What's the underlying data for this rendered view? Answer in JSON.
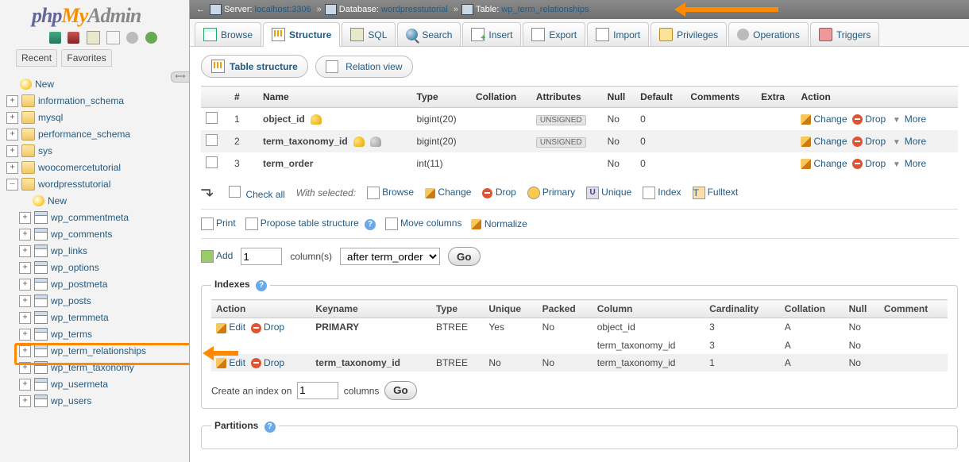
{
  "logo": {
    "p": "php",
    "m": "My",
    "a": "Admin"
  },
  "nav": {
    "recent": "Recent",
    "favorites": "Favorites"
  },
  "tree": {
    "new": "New",
    "dbs": [
      "information_schema",
      "mysql",
      "performance_schema",
      "sys",
      "woocomercetutorial"
    ],
    "open_db": "wordpresstutorial",
    "tables": [
      "wp_commentmeta",
      "wp_comments",
      "wp_links",
      "wp_options",
      "wp_postmeta",
      "wp_posts",
      "wp_termmeta",
      "wp_terms",
      "wp_term_relationships",
      "wp_term_taxonomy",
      "wp_usermeta",
      "wp_users"
    ]
  },
  "bc": {
    "server_lbl": "Server:",
    "server": "localhost:3306",
    "db_lbl": "Database:",
    "db": "wordpresstutorial",
    "tbl_lbl": "Table:",
    "tbl": "wp_term_relationships"
  },
  "tabs": {
    "browse": "Browse",
    "structure": "Structure",
    "sql": "SQL",
    "search": "Search",
    "insert": "Insert",
    "export": "Export",
    "import": "Import",
    "privileges": "Privileges",
    "operations": "Operations",
    "triggers": "Triggers"
  },
  "subtabs": {
    "ts": "Table structure",
    "rv": "Relation view"
  },
  "cols": {
    "headers": {
      "num": "#",
      "name": "Name",
      "type": "Type",
      "collation": "Collation",
      "attributes": "Attributes",
      "null": "Null",
      "default": "Default",
      "comments": "Comments",
      "extra": "Extra",
      "action": "Action"
    },
    "rows": [
      {
        "n": "1",
        "name": "object_id",
        "type": "bigint(20)",
        "attr": "UNSIGNED",
        "null": "No",
        "def": "0",
        "pk": true
      },
      {
        "n": "2",
        "name": "term_taxonomy_id",
        "type": "bigint(20)",
        "attr": "UNSIGNED",
        "null": "No",
        "def": "0",
        "pk": true,
        "idx": true
      },
      {
        "n": "3",
        "name": "term_order",
        "type": "int(11)",
        "attr": "",
        "null": "No",
        "def": "0"
      }
    ],
    "change": "Change",
    "drop": "Drop",
    "more": "More"
  },
  "wsel": {
    "checkall": "Check all",
    "label": "With selected:",
    "browse": "Browse",
    "change": "Change",
    "drop": "Drop",
    "primary": "Primary",
    "unique": "Unique",
    "index": "Index",
    "fulltext": "Fulltext"
  },
  "tools": {
    "print": "Print",
    "propose": "Propose table structure",
    "move": "Move columns",
    "norm": "Normalize"
  },
  "addrow": {
    "add": "Add",
    "count": "1",
    "col": "column(s)",
    "after_options": [
      "after term_order"
    ],
    "after": "after term_order",
    "go": "Go"
  },
  "indexes": {
    "legend": "Indexes",
    "headers": {
      "action": "Action",
      "key": "Keyname",
      "type": "Type",
      "unique": "Unique",
      "packed": "Packed",
      "column": "Column",
      "card": "Cardinality",
      "coll": "Collation",
      "null": "Null",
      "comment": "Comment"
    },
    "rows": [
      {
        "edit": "Edit",
        "drop": "Drop",
        "key": "PRIMARY",
        "type": "BTREE",
        "uni": "Yes",
        "packed": "No",
        "col": "object_id",
        "card": "3",
        "coll": "A",
        "null": "No"
      },
      {
        "cont": true,
        "col": "term_taxonomy_id",
        "card": "3",
        "coll": "A",
        "null": "No"
      },
      {
        "edit": "Edit",
        "drop": "Drop",
        "key": "term_taxonomy_id",
        "type": "BTREE",
        "uni": "No",
        "packed": "No",
        "col": "term_taxonomy_id",
        "card": "1",
        "coll": "A",
        "null": "No"
      }
    ],
    "create_lbl": "Create an index on",
    "create_n": "1",
    "create_cols": "columns",
    "go": "Go"
  },
  "partitions": {
    "legend": "Partitions"
  }
}
